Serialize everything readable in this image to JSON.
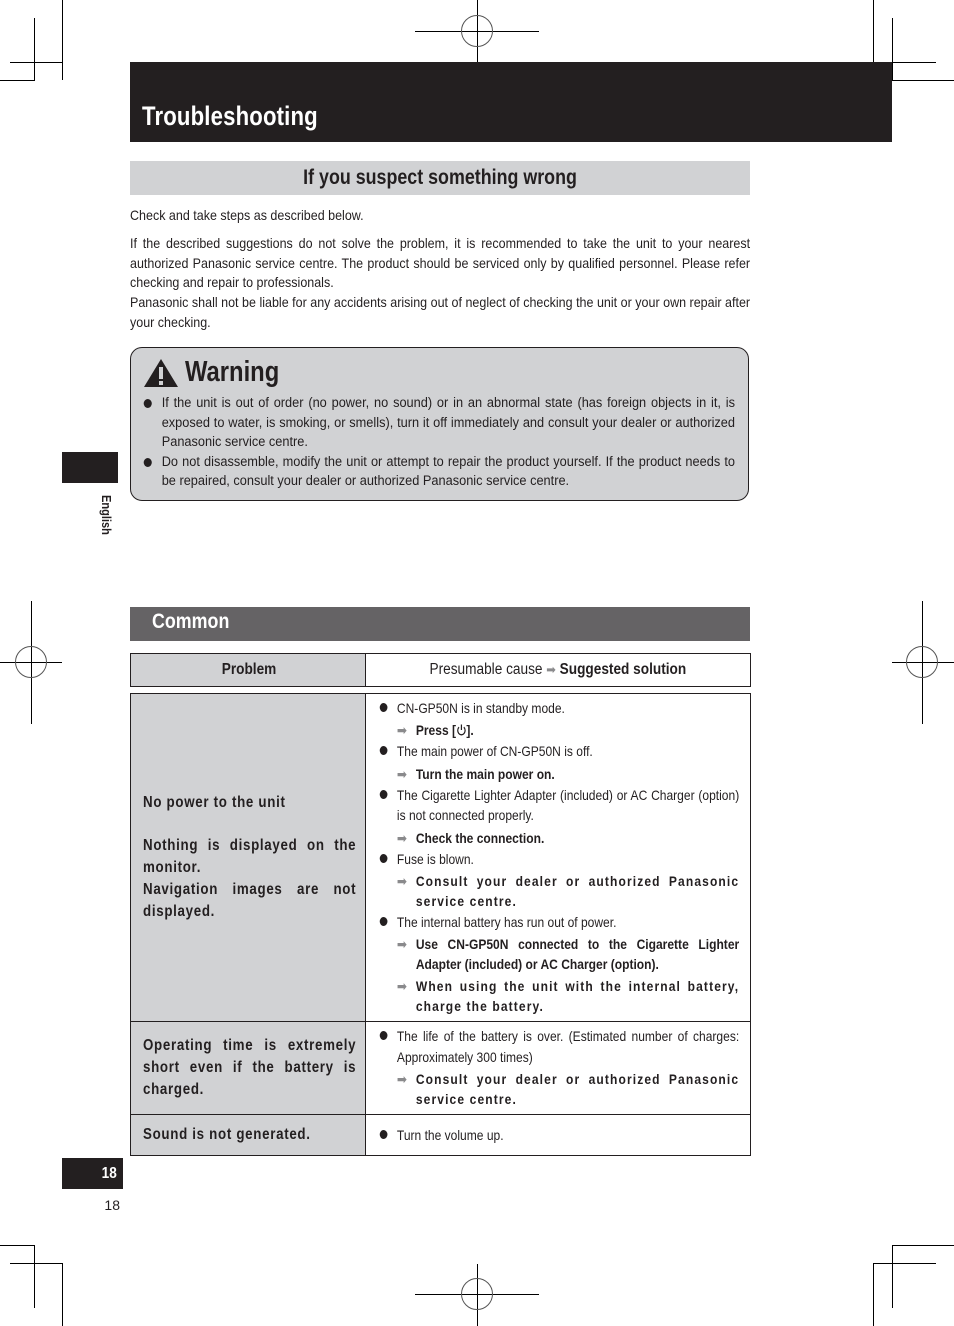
{
  "header": {
    "title": "Troubleshooting"
  },
  "section": {
    "heading": "If you suspect something wrong",
    "intro": "Check and take steps as described below.",
    "paragraph_1": "If the described suggestions do not solve the problem, it is recommended to take the unit to your nearest authorized Panasonic service centre. The product should be serviced only by qualified personnel. Please refer checking and repair to professionals.",
    "paragraph_2": "Panasonic shall not be liable for any accidents arising out of neglect of checking the unit or your own repair after your checking."
  },
  "warning": {
    "icon": "warning-triangle-icon",
    "title": "Warning",
    "items": [
      "If the unit is out of order (no power, no sound) or in an abnormal state (has foreign objects in it, is exposed to water, is smoking, or smells), turn it off immediately and consult your dealer or authorized Panasonic service centre.",
      "Do not disassemble, modify the unit or attempt to repair the product yourself. If the product needs to be repaired, consult your dealer or authorized Panasonic service centre."
    ]
  },
  "sidebar": {
    "language": "English"
  },
  "common": {
    "heading": "Common",
    "table_header": {
      "problem": "Problem",
      "cause": "Presumable cause",
      "arrow": "➡",
      "solution": "Suggested solution"
    },
    "rows": [
      {
        "problem": [
          "No power to the unit",
          "Nothing is displayed on the monitor.",
          "Navigation images are not displayed."
        ],
        "causes": [
          {
            "cause": "CN-GP50N is in standby mode.",
            "solutions": [
              "Press [",
              "]."
            ],
            "solution_icon": "power-icon"
          },
          {
            "cause": "The main power of CN-GP50N is off.",
            "solutions": [
              "Turn the main power on."
            ]
          },
          {
            "cause": "The Cigarette Lighter Adapter (included) or AC Charger (option) is not connected properly.",
            "solutions": [
              "Check the connection."
            ]
          },
          {
            "cause": "Fuse is blown.",
            "solutions": [
              "Consult your dealer or authorized Panasonic service centre."
            ]
          },
          {
            "cause": "The internal battery has run out of power.",
            "solutions": [
              "Use CN-GP50N connected to the Cigarette Lighter Adapter (included) or AC Charger (option).",
              "When using the unit with the internal battery, charge the battery."
            ]
          }
        ]
      },
      {
        "problem": [
          "Operating time is extremely short even if the battery is charged."
        ],
        "causes": [
          {
            "cause": "The life of the battery is over. (Estimated number of charges: Approximately 300 times)",
            "solutions": [
              "Consult your dealer or authorized Panasonic service centre."
            ]
          }
        ]
      },
      {
        "problem": [
          "Sound is not generated."
        ],
        "causes": [
          {
            "cause": "Turn the volume up.",
            "solutions": []
          }
        ]
      }
    ]
  },
  "footer": {
    "page_tab": "18",
    "page_number": "18"
  }
}
